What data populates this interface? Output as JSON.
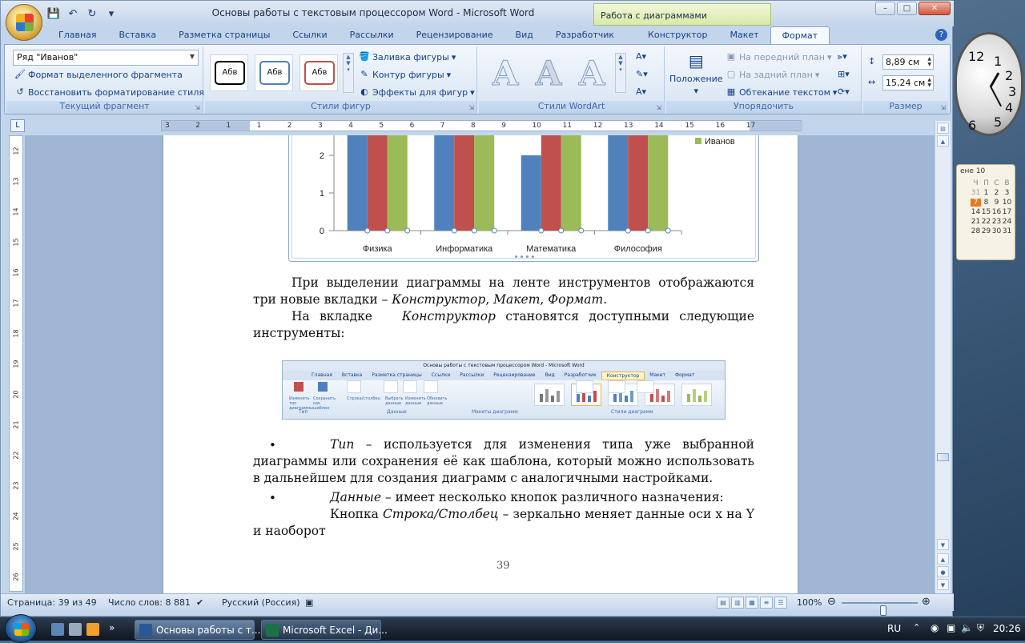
{
  "window": {
    "title": "Основы работы с текстовым процессором Word - Microsoft Word",
    "context_title": "Работа с диаграммами",
    "min": "–",
    "max": "□",
    "close": "✕"
  },
  "tabs": [
    "Главная",
    "Вставка",
    "Разметка страницы",
    "Ссылки",
    "Рассылки",
    "Рецензирование",
    "Вид",
    "Разработчик",
    "Конструктор",
    "Макет",
    "Формат"
  ],
  "ribbon": {
    "current_fragment": {
      "selector_value": "Ряд \"Иванов\"",
      "format_selection": "Формат выделенного фрагмента",
      "reset_style": "Восстановить форматирование стиля",
      "label": "Текущий фрагмент"
    },
    "shape_styles": {
      "thumbs": [
        "Абв",
        "Абв",
        "Абв"
      ],
      "thumb_colors": [
        "#000000",
        "#4f81bd",
        "#c0504d"
      ],
      "fill": "Заливка фигуры",
      "outline": "Контур фигуры",
      "effects": "Эффекты для фигур",
      "label": "Стили фигур"
    },
    "wordart": {
      "glyph": "A",
      "label": "Стили WordArt"
    },
    "arrange": {
      "position": "Положение",
      "bring_front": "На передний план",
      "send_back": "На задний план",
      "wrap": "Обтекание текстом",
      "label": "Упорядочить"
    },
    "size": {
      "height": "8,89 см",
      "width": "15,24 см",
      "label": "Размер"
    }
  },
  "hruler": {
    "labels": [
      "3",
      "2",
      "1",
      "1",
      "2",
      "3",
      "4",
      "5",
      "6",
      "7",
      "8",
      "9",
      "10",
      "11",
      "12",
      "13",
      "14",
      "15",
      "16",
      "17"
    ]
  },
  "vruler": {
    "labels": [
      "12",
      "13",
      "14",
      "15",
      "16",
      "17",
      "18",
      "19",
      "20",
      "21",
      "22",
      "23",
      "24",
      "25",
      "26"
    ]
  },
  "chart_data": {
    "type": "bar",
    "categories": [
      "Физика",
      "Информатика",
      "Математика",
      "Философия"
    ],
    "series": [
      {
        "name": "",
        "color": "#4f81bd",
        "values": [
          3,
          3,
          2,
          3
        ]
      },
      {
        "name": "",
        "color": "#c0504d",
        "values": [
          3,
          3,
          3,
          3
        ]
      },
      {
        "name": "Иванов",
        "color": "#9bbb59",
        "values": [
          3,
          3,
          3,
          3
        ]
      }
    ],
    "yticks": [
      "0",
      "1",
      "2"
    ],
    "ylim": [
      0,
      3
    ]
  },
  "document": {
    "para1": "При выделении диаграммы на ленте инструментов отображаются три новые вкладки –",
    "para1_t1": "Конструктор",
    "para1_t2": "Макет",
    "para1_t3": "Формат",
    "para2_a": "На вкладке",
    "para2_t": "Конструктор",
    "para2_b": "становятся доступными следующие инструменты:",
    "bullet": "•",
    "b1_term": "Тип",
    "b1_text": "– используется для изменения типа уже выбранной диаграммы или сохранения её как шаблона, который можно использовать в дальнейшем для создания диаграмм с аналогичными настройками.",
    "b2_term": "Данные",
    "b2_text": "– имеет несколько кнопок различного назначения:",
    "p3_a": "Кнопка",
    "p3_term": "Строка/Столбец",
    "p3_b": "– зеркально меняет данные оси x на Y и наоборот",
    "page_number": "39"
  },
  "embedded": {
    "title": "Основы работы с текстовым процессором Word - Microsoft Word",
    "context": "Работа с диаграммами",
    "tabs": [
      "Главная",
      "Вставка",
      "Разметка страницы",
      "Ссылки",
      "Рассылки",
      "Рецензирование",
      "Вид",
      "Разработчик",
      "Конструктор",
      "Макет",
      "Формат"
    ],
    "btns": [
      "Изменить тип диаграммы",
      "Сохранить как шаблон",
      "Строка/столбец",
      "Выбрать данные",
      "Изменить данные",
      "Обновить данные"
    ],
    "groups": [
      "Тип",
      "Данные",
      "Макеты диаграмм",
      "Стили диаграмм"
    ]
  },
  "status": {
    "page": "Страница: 39 из 49",
    "words": "Число слов: 8 881",
    "lang": "Русский (Россия)",
    "zoom": "100%",
    "zoom_level": 0.55
  },
  "taskbar": {
    "btn1": "Основы работы с т...",
    "btn2": "Microsoft Excel - Ди...",
    "lang": "RU",
    "time": "20:26"
  },
  "gadgets": {
    "month": "ене 10",
    "days_head": [
      "Ч",
      "П",
      "С",
      "В"
    ],
    "days": [
      "31",
      "1",
      "2",
      "3",
      "7",
      "8",
      "9",
      "10",
      "14",
      "15",
      "16",
      "17",
      "21",
      "22",
      "23",
      "24",
      "28",
      "29",
      "30",
      "31"
    ],
    "clock_nums": [
      "12",
      "1",
      "2",
      "3",
      "4",
      "5",
      "6"
    ]
  }
}
